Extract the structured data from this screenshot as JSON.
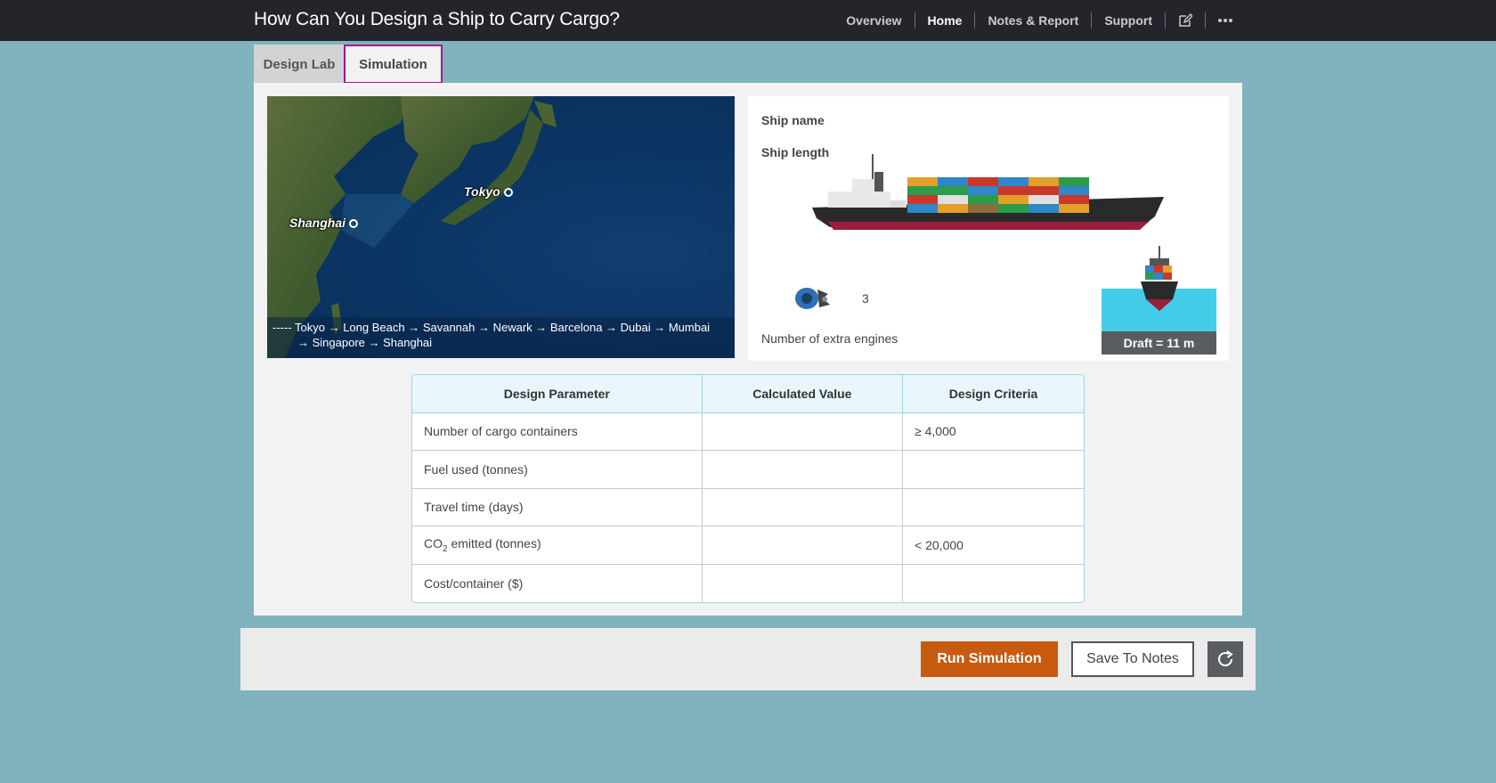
{
  "header": {
    "title": "How Can You Design a Ship to Carry Cargo?",
    "nav": [
      "Overview",
      "Home",
      "Notes & Report",
      "Support"
    ],
    "active_nav": "Home",
    "icons": [
      "edit-icon",
      "more-icon"
    ]
  },
  "tabs": [
    {
      "label": "Design Lab",
      "selected": false
    },
    {
      "label": "Simulation",
      "selected": true
    }
  ],
  "map": {
    "cities": [
      "Tokyo",
      "Shanghai"
    ],
    "route_line1": "----- Tokyo → Long Beach → Savannah → Newark → Barcelona → Dubai → Mumbai",
    "route_line2": "→ Singapore → Shanghai"
  },
  "ship": {
    "name_label": "Ship name",
    "length_label": "Ship length",
    "extra_engines_value": "3",
    "extra_engines_label": "Number of extra engines",
    "draft": "Draft = 11 m"
  },
  "table": {
    "headers": [
      "Design Parameter",
      "Calculated Value",
      "Design Criteria"
    ],
    "rows": [
      {
        "param": "Number of cargo containers",
        "value": "",
        "criteria": "≥ 4,000"
      },
      {
        "param": "Fuel used (tonnes)",
        "value": "",
        "criteria": ""
      },
      {
        "param": "Travel time (days)",
        "value": "",
        "criteria": ""
      },
      {
        "param_prefix": "CO",
        "param_sub": "2",
        "param_suffix": " emitted (tonnes)",
        "value": "",
        "criteria": "< 20,000"
      },
      {
        "param": "Cost/container ($)",
        "value": "",
        "criteria": ""
      }
    ]
  },
  "footer": {
    "run_label": "Run Simulation",
    "save_label": "Save To Notes",
    "reset_icon": "refresh-icon"
  },
  "colors": {
    "topbar": "#23252b",
    "background": "#80b3be",
    "run_button": "#c75a0f",
    "tab_focus": "#a3198f",
    "water": "#44cde9"
  }
}
